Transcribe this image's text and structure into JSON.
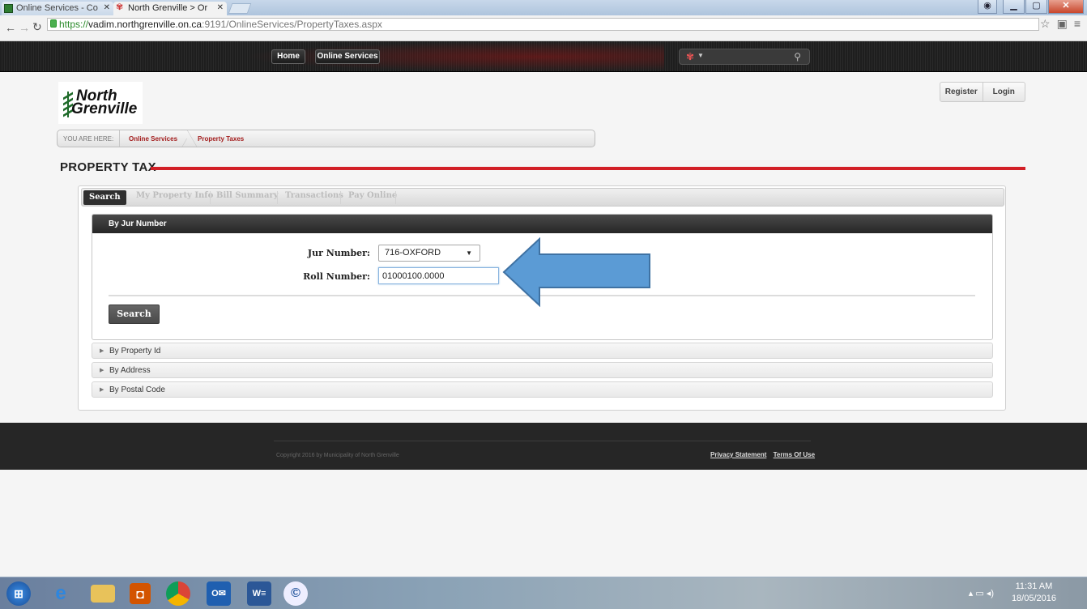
{
  "browser": {
    "tabs": [
      {
        "label": "Online Services - Co"
      },
      {
        "label": "North Grenville > Or"
      }
    ],
    "url": {
      "scheme": "https://",
      "host": "vadim.northgrenville.on.ca",
      "path": ":9191/OnlineServices/PropertyTaxes.aspx"
    }
  },
  "site_nav": {
    "home": "Home",
    "online_services": "Online Services"
  },
  "logo": {
    "line1": "North",
    "line2": "Grenville"
  },
  "auth": {
    "register": "Register",
    "login": "Login"
  },
  "breadcrumb": {
    "label": "YOU ARE HERE:",
    "items": [
      "Online Services",
      "Property Taxes"
    ]
  },
  "page_title": "PROPERTY TAX",
  "tabs": [
    "Search",
    "My Property Info",
    "Bill Summary",
    "Transactions",
    "Pay Online"
  ],
  "search_section": {
    "title": "By Jur Number",
    "jur_label": "Jur Number:",
    "jur_value": "716-OXFORD",
    "roll_label": "Roll Number:",
    "roll_value": "01000100.0000",
    "search_button": "Search"
  },
  "accordion": [
    "By Property Id",
    "By Address",
    "By Postal Code"
  ],
  "footer": {
    "copyright": "Copyright 2016 by Municipality of North Grenville",
    "privacy": "Privacy Statement",
    "terms": "Terms Of Use"
  },
  "taskbar": {
    "time": "11:31 AM",
    "date": "18/05/2016"
  },
  "colors": {
    "accent_red": "#d21f26",
    "breadcrumb_link": "#a31d1d",
    "arrow_blue": "#5b9bd5"
  }
}
